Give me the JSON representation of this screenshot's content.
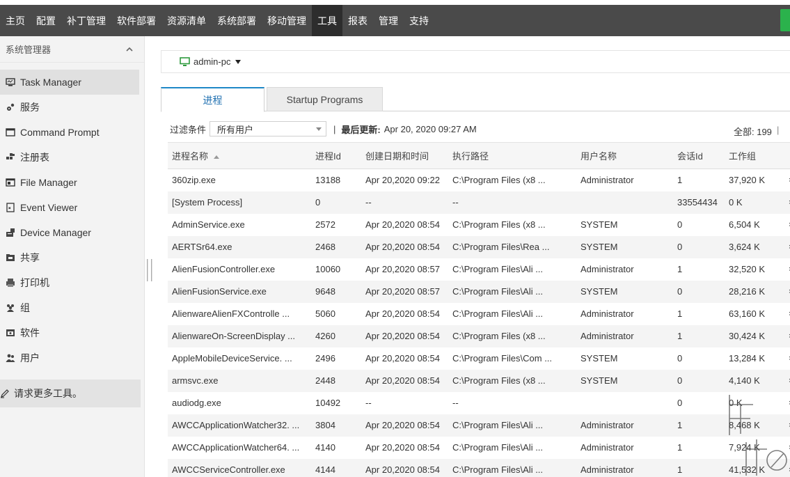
{
  "topnav": {
    "items": [
      "主页",
      "配置",
      "补丁管理",
      "软件部署",
      "资源清单",
      "系统部署",
      "移动管理",
      "工具",
      "报表",
      "管理",
      "支持"
    ],
    "active": "工具"
  },
  "sidebar": {
    "header": "系统管理器",
    "items": [
      {
        "label": "Task Manager",
        "icon": "monitor-icon"
      },
      {
        "label": "服务",
        "icon": "services-icon"
      },
      {
        "label": "Command Prompt",
        "icon": "terminal-icon"
      },
      {
        "label": "注册表",
        "icon": "registry-icon"
      },
      {
        "label": "File Manager",
        "icon": "file-manager-icon"
      },
      {
        "label": "Event Viewer",
        "icon": "event-viewer-icon"
      },
      {
        "label": "Device Manager",
        "icon": "device-manager-icon"
      },
      {
        "label": "共享",
        "icon": "share-icon"
      },
      {
        "label": "打印机",
        "icon": "printer-icon"
      },
      {
        "label": "组",
        "icon": "group-icon"
      },
      {
        "label": "软件",
        "icon": "software-icon"
      },
      {
        "label": "用户",
        "icon": "users-icon"
      }
    ],
    "more_tools": "请求更多工具。"
  },
  "computer": {
    "name": "admin-pc"
  },
  "tabs": {
    "processes": "进程",
    "startup": "Startup Programs"
  },
  "filter": {
    "label": "过滤条件",
    "value": "所有用户",
    "separator": "|",
    "updated_label": "最后更新:",
    "updated_value": "Apr 20, 2020 09:27 AM",
    "total": "全部: 199",
    "total_sep": "|"
  },
  "table": {
    "headers": [
      "进程名称",
      "进程Id",
      "创建日期和时间",
      "执行路径",
      "用户名称",
      "会话Id",
      "工作组"
    ],
    "rows": [
      [
        "360zip.exe",
        "13188",
        "Apr 20,2020 09:22",
        "C:\\Program Files (x8 ...",
        "Administrator",
        "1",
        "37,920 K"
      ],
      [
        "[System Process]",
        "0",
        "--",
        "--",
        "",
        "33554434",
        "0 K"
      ],
      [
        "AdminService.exe",
        "2572",
        "Apr 20,2020 08:54",
        "C:\\Program Files (x8 ...",
        "SYSTEM",
        "0",
        "6,504 K"
      ],
      [
        "AERTSr64.exe",
        "2468",
        "Apr 20,2020 08:54",
        "C:\\Program Files\\Rea ...",
        "SYSTEM",
        "0",
        "3,624 K"
      ],
      [
        "AlienFusionController.exe",
        "10060",
        "Apr 20,2020 08:57",
        "C:\\Program Files\\Ali ...",
        "Administrator",
        "1",
        "32,520 K"
      ],
      [
        "AlienFusionService.exe",
        "9648",
        "Apr 20,2020 08:57",
        "C:\\Program Files\\Ali ...",
        "SYSTEM",
        "0",
        "28,216 K"
      ],
      [
        "AlienwareAlienFXControlle ...",
        "5060",
        "Apr 20,2020 08:54",
        "C:\\Program Files\\Ali ...",
        "Administrator",
        "1",
        "63,160 K"
      ],
      [
        "AlienwareOn-ScreenDisplay ...",
        "4260",
        "Apr 20,2020 08:54",
        "C:\\Program Files (x8 ...",
        "Administrator",
        "1",
        "30,424 K"
      ],
      [
        "AppleMobileDeviceService. ...",
        "2496",
        "Apr 20,2020 08:54",
        "C:\\Program Files\\Com ...",
        "SYSTEM",
        "0",
        "13,284 K"
      ],
      [
        "armsvc.exe",
        "2448",
        "Apr 20,2020 08:54",
        "C:\\Program Files (x8 ...",
        "SYSTEM",
        "0",
        "4,140 K"
      ],
      [
        "audiodg.exe",
        "10492",
        "--",
        "--",
        "",
        "0",
        "0 K"
      ],
      [
        "AWCCApplicationWatcher32. ...",
        "3804",
        "Apr 20,2020 08:54",
        "C:\\Program Files\\Ali ...",
        "Administrator",
        "1",
        "8,468 K"
      ],
      [
        "AWCCApplicationWatcher64. ...",
        "4140",
        "Apr 20,2020 08:54",
        "C:\\Program Files\\Ali ...",
        "Administrator",
        "1",
        "7,924 K"
      ],
      [
        "AWCCServiceController.exe",
        "4144",
        "Apr 20,2020 08:54",
        "C:\\Program Files\\Ali ...",
        "Administrator",
        "1",
        "41,532 K"
      ]
    ],
    "row_action": "×"
  },
  "colors": {
    "topbar": "#4a4a4a",
    "topbar_active": "#2d2d2d",
    "accent": "#1e88c7",
    "green": "#2bb24c"
  }
}
